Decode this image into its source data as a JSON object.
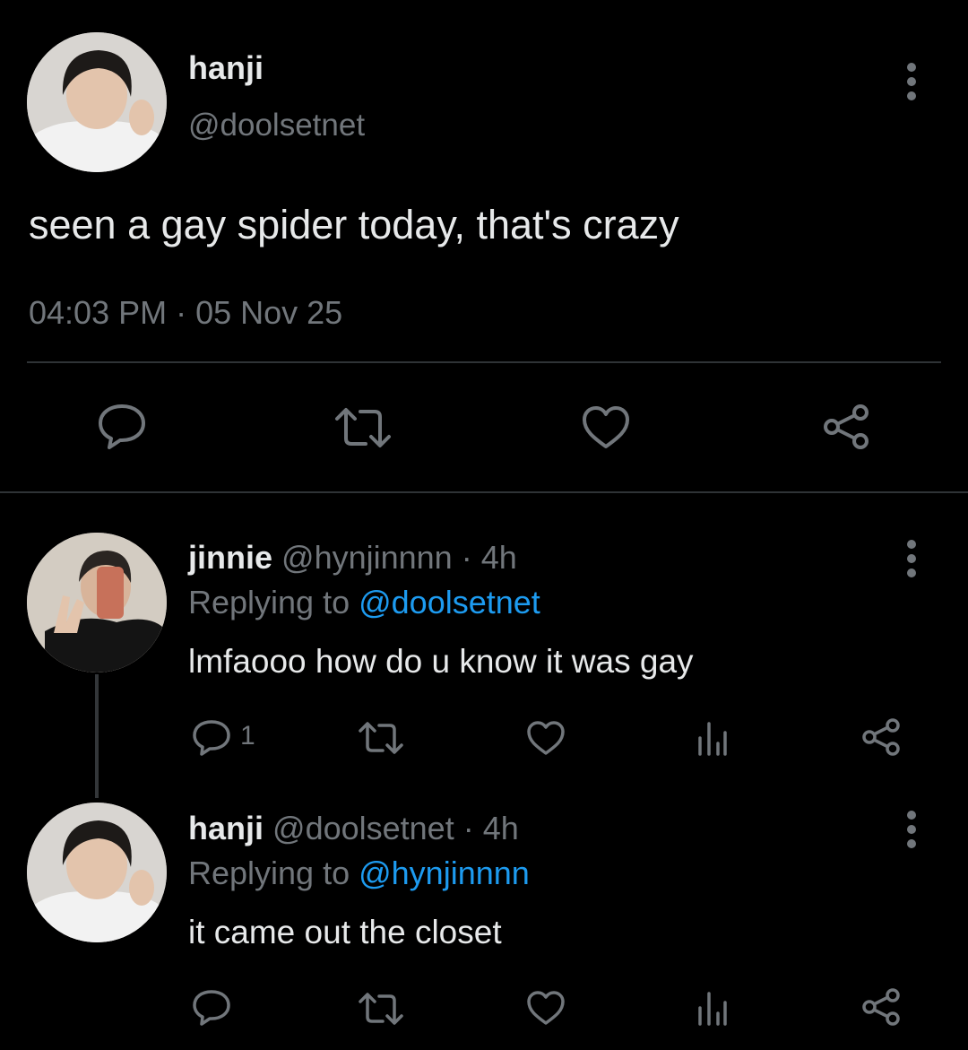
{
  "main_tweet": {
    "display_name": "hanji",
    "handle": "@doolsetnet",
    "text": "seen a gay spider today, that's crazy",
    "timestamp": "04:03 PM · 05 Nov 25"
  },
  "replies": [
    {
      "display_name": "jinnie",
      "handle_time": "@hynjinnnn · 4h",
      "replying_prefix": "Replying to ",
      "replying_handle": "@doolsetnet",
      "text": "lmfaooo how do u know it was gay",
      "reply_count": "1"
    },
    {
      "display_name": "hanji",
      "handle_time": "@doolsetnet · 4h",
      "replying_prefix": "Replying to ",
      "replying_handle": "@hynjinnnn",
      "text": "it came out the closet",
      "reply_count": ""
    }
  ],
  "icons": {
    "reply": "reply-icon",
    "retweet": "retweet-icon",
    "like": "heart-icon",
    "views": "views-icon",
    "share": "share-icon",
    "more": "more-vertical-icon"
  },
  "colors": {
    "background": "#000000",
    "text": "#e7e9ea",
    "muted": "#71767b",
    "link": "#1d9bf0",
    "divider": "#2f3336"
  }
}
